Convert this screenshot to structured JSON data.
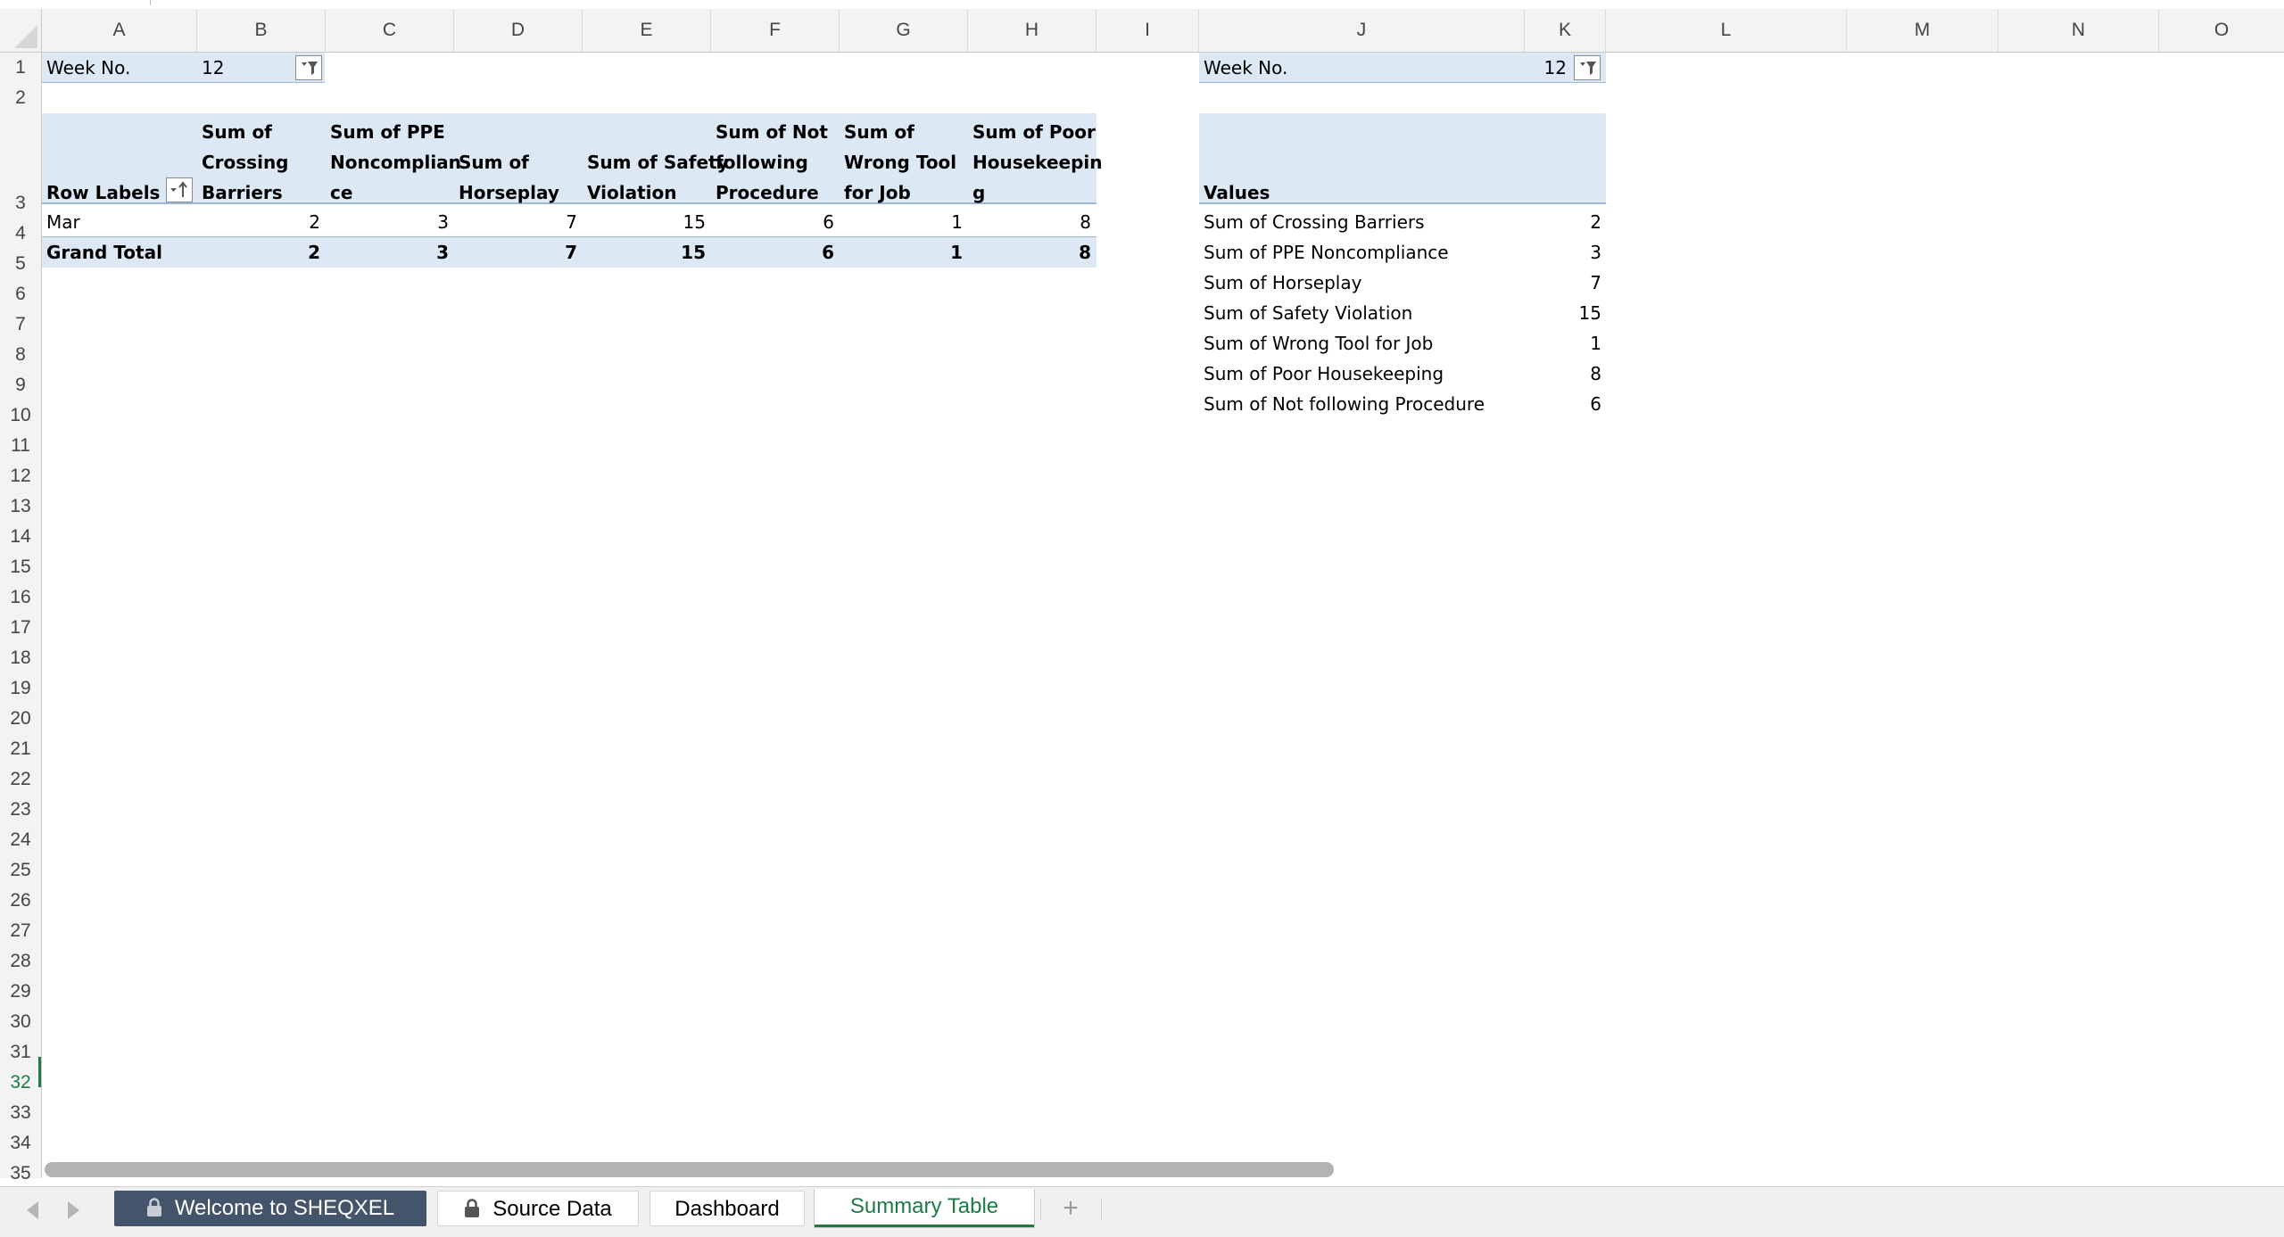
{
  "columns": [
    "A",
    "B",
    "C",
    "D",
    "E",
    "F",
    "G",
    "H",
    "I",
    "J",
    "K",
    "L",
    "M",
    "N",
    "O"
  ],
  "rows": [
    "1",
    "2",
    "3",
    "4",
    "5",
    "6",
    "7",
    "8",
    "9",
    "10",
    "11",
    "12",
    "13",
    "14",
    "15",
    "16",
    "17",
    "18",
    "19",
    "20",
    "21",
    "22",
    "23",
    "24",
    "25",
    "26",
    "27",
    "28",
    "29",
    "30",
    "31",
    "32",
    "33",
    "34",
    "35"
  ],
  "active_row": "32",
  "left_pivot": {
    "filter_label": "Week No.",
    "filter_value": "12",
    "row_labels": "Row Labels",
    "headers": [
      [
        "Sum of",
        "Crossing",
        "Barriers"
      ],
      [
        "Sum of PPE",
        "Noncomplian",
        "ce"
      ],
      [
        "Sum of",
        "Horseplay"
      ],
      [
        "Sum of Safety",
        "Violation"
      ],
      [
        "Sum of Not",
        "following",
        "Procedure"
      ],
      [
        "Sum of",
        "Wrong Tool",
        "for Job"
      ],
      [
        "Sum of Poor",
        "Housekeepin",
        "g"
      ]
    ],
    "data_row": {
      "label": "Mar",
      "values": [
        "2",
        "3",
        "7",
        "15",
        "6",
        "1",
        "8"
      ]
    },
    "total_row": {
      "label": "Grand Total",
      "values": [
        "2",
        "3",
        "7",
        "15",
        "6",
        "1",
        "8"
      ]
    }
  },
  "right_pivot": {
    "filter_label": "Week No.",
    "filter_value": "12",
    "values_header": "Values",
    "items": [
      {
        "label": "Sum of Crossing Barriers",
        "value": "2"
      },
      {
        "label": "Sum of PPE Noncompliance",
        "value": "3"
      },
      {
        "label": "Sum of Horseplay",
        "value": "7"
      },
      {
        "label": "Sum of Safety Violation",
        "value": "15"
      },
      {
        "label": "Sum of Wrong Tool for Job",
        "value": "1"
      },
      {
        "label": "Sum of Poor Housekeeping",
        "value": "8"
      },
      {
        "label": "Sum of Not following Procedure",
        "value": "6"
      }
    ]
  },
  "sheet_tabs": {
    "welcome": "Welcome to SHEQXEL",
    "source": "Source Data",
    "dashboard": "Dashboard",
    "summary": "Summary Table",
    "add": "+"
  },
  "colors": {
    "pivot_band": "#dde8f5",
    "active_green": "#1e7b45",
    "welcome_tab": "#44546a"
  }
}
